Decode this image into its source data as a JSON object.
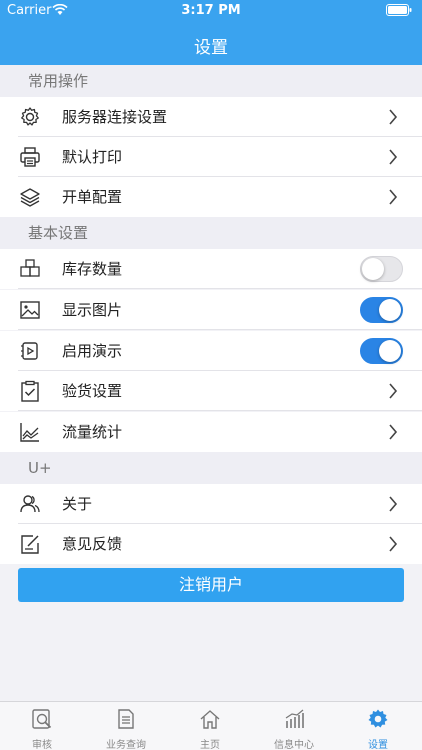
{
  "status_bar": {
    "carrier": "Carrier",
    "time": "3:17 PM"
  },
  "nav": {
    "title": "设置"
  },
  "sections": {
    "common": "常用操作",
    "basic": "基本设置",
    "uplus": "U+"
  },
  "rows": {
    "server": "服务器连接设置",
    "printer": "默认打印",
    "order": "开单配置",
    "stock": "库存数量",
    "image": "显示图片",
    "demo": "启用演示",
    "inspect": "验货设置",
    "traffic": "流量统计",
    "about": "关于",
    "feedback": "意见反馈"
  },
  "toggles": {
    "stock": false,
    "image": true,
    "demo": true
  },
  "logout_label": "注销用户",
  "tabs": [
    "审核",
    "业务查询",
    "主页",
    "信息中心",
    "设置"
  ],
  "active_tab": "设置",
  "colors": {
    "header": "#3aa3ef",
    "accent": "#2a84e5",
    "button": "#31a2f0"
  }
}
